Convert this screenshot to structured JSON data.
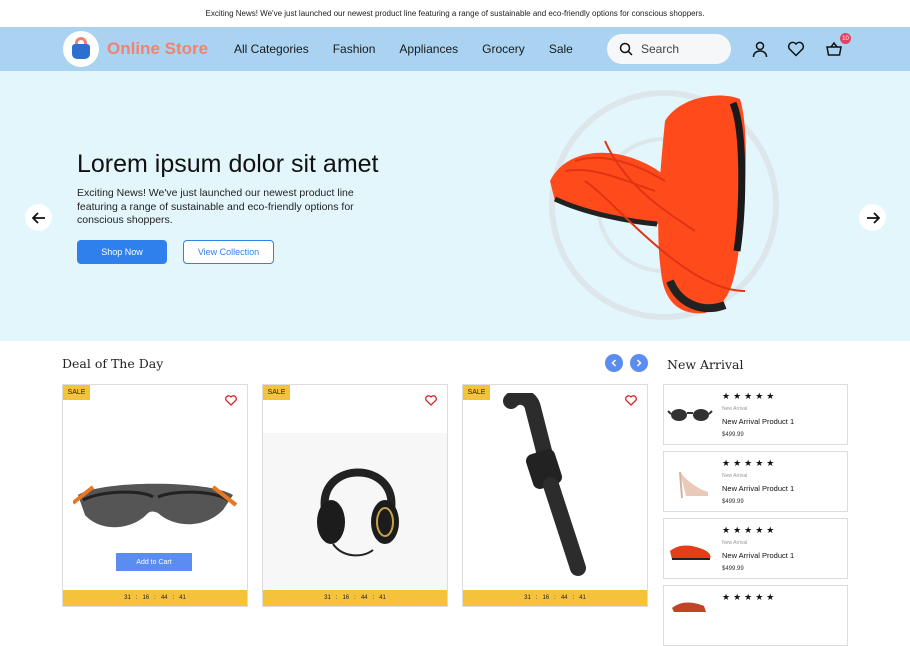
{
  "announcement": "Exciting News! We've just launched our newest product line featuring a range of sustainable and eco-friendly options for conscious shoppers.",
  "brand": {
    "name": "Online Store",
    "color": "#f0836f"
  },
  "nav": {
    "items": [
      "All Categories",
      "Fashion",
      "Appliances",
      "Grocery",
      "Sale"
    ],
    "search_placeholder": "Search",
    "cart_count": "10",
    "icons": [
      "search-icon",
      "user-icon",
      "heart-icon",
      "cart-icon"
    ]
  },
  "hero": {
    "title": "Lorem ipsum dolor sit amet",
    "text": "Exciting News! We've just launched our newest product line featuring a range of sustainable and eco-friendly options for conscious shoppers.",
    "primary_button": "Shop Now",
    "secondary_button": "View  Collection"
  },
  "deals": {
    "title": "Deal of The Day",
    "products": [
      {
        "badge": "SALE",
        "image": "sunglasses",
        "action": "Add to Cart",
        "timer": [
          "31",
          "16",
          "44",
          "41"
        ]
      },
      {
        "badge": "SALE",
        "image": "headphones",
        "timer": [
          "31",
          "16",
          "44",
          "41"
        ]
      },
      {
        "badge": "SALE",
        "image": "smartwatch",
        "timer": [
          "31",
          "16",
          "44",
          "41"
        ]
      }
    ]
  },
  "new_arrival": {
    "title": "New Arrival",
    "items": [
      {
        "stars": "★★★★★",
        "category": "New Arrival",
        "name": "New Arrival Product 1",
        "price": "$499.99",
        "image": "sunglasses"
      },
      {
        "stars": "★★★★★",
        "category": "New Arrival",
        "name": "New Arrival Product 1",
        "price": "$499.99",
        "image": "heel"
      },
      {
        "stars": "★★★★★",
        "category": "New Arrival",
        "name": "New Arrival Product 1",
        "price": "$499.99",
        "image": "sneaker"
      },
      {
        "stars": "★★★★★",
        "image": "sneaker"
      }
    ]
  },
  "colors": {
    "nav_bg": "#a9d3f0",
    "hero_bg": "#e3f6fc",
    "primary": "#2f80ed",
    "sale": "#f5c33b",
    "heart": "#d8232a"
  }
}
